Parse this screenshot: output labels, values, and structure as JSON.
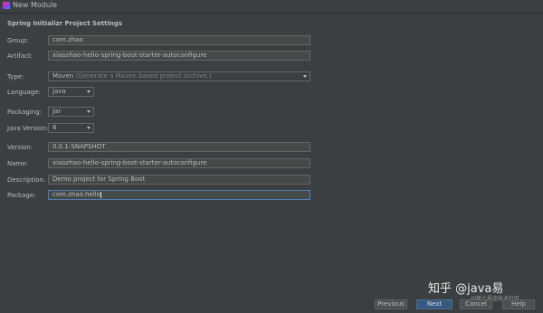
{
  "window": {
    "title": "New Module"
  },
  "section_title": "Spring Initializr Project Settings",
  "form": {
    "group": {
      "label": "Group:",
      "value": "com.zhao"
    },
    "artifact": {
      "label": "Artifact:",
      "value": "xiaozhao-hello-spring-boot-starter-autoconfigure"
    },
    "type": {
      "label": "Type:",
      "value": "Maven",
      "hint": "(Generate a Maven based project archive.)"
    },
    "language": {
      "label": "Language:",
      "value": "Java"
    },
    "packaging": {
      "label": "Packaging:",
      "value": "Jar"
    },
    "java_version": {
      "label": "Java Version:",
      "value": "8"
    },
    "version": {
      "label": "Version:",
      "value": "0.0.1-SNAPSHOT"
    },
    "name": {
      "label": "Name:",
      "value": "xiaozhao-hello-spring-boot-starter-autoconfigure"
    },
    "description": {
      "label": "Description:",
      "value": "Demo project for Spring Boot"
    },
    "package": {
      "label": "Package:",
      "value": "com.zhao.hello"
    }
  },
  "buttons": {
    "previous": "Previous",
    "next": "Next",
    "cancel": "Cancel",
    "help": "Help"
  },
  "watermark": {
    "main": "知乎 @java易",
    "sub": "@稀土掘金技术社区"
  },
  "colors": {
    "background": "#3c3f41",
    "field_bg": "#45494a",
    "primary_button": "#365880",
    "focus_border": "#4f7fb5"
  }
}
